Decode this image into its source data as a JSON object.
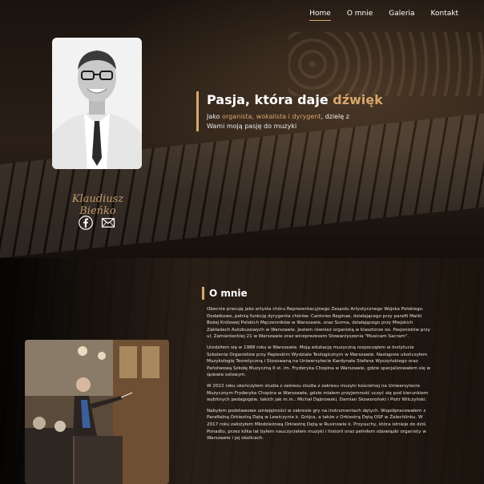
{
  "nav": {
    "items": [
      {
        "label": "Home",
        "active": true
      },
      {
        "label": "O mnie",
        "active": false
      },
      {
        "label": "Galeria",
        "active": false
      },
      {
        "label": "Kontakt",
        "active": false
      }
    ]
  },
  "hero": {
    "title_part1": "Pasja, która daje ",
    "title_accent": "dźwięk",
    "subtitle_part1": "Jako ",
    "subtitle_accent": "organista, wokalista i dyrygent",
    "subtitle_part2": ", dzielę z Wami moją pasję do muzyki",
    "signature": "Klaudiusz Bieńko",
    "socials": [
      {
        "icon": "facebook-icon"
      },
      {
        "icon": "mail-icon"
      }
    ]
  },
  "about": {
    "title": "O mnie",
    "paragraphs": [
      "Obecnie pracuję jako artysta chóru Reprezentacyjnego Zespołu Artystycznego Wojska Polskiego. Dodatkowo, pełnię funkcję dyrygenta chórów: Cantores Reginae, działającego przy parafii Matki Bożej Królowej Polskich Męczenników w Warszawie, oraz Surma, działającego przy Miejskich Zakładach Autobusowych w Warszawie. Jestem również organistą w klasztorze oo. Pasjonistów przy ul. Zamienieckiej 21 w Warszawie oraz wiceprezesem Stowarzyszenia \"Musicam Sacram\".",
      "Urodziłem się w 1988 roku w Warszawie. Moją edukację muzyczną rozpocząłem w Instytucie Szkolenia Organistów przy Papieskim Wydziale Teologicznym w Warszawie. Następnie ukończyłem Muzykologię Teoretyczną i Stosowaną na Uniwersytecie Kardynała Stefana Wyszyńskiego oraz Państwową Szkołę Muzyczną II st. im. Fryderyka Chopina w Warszawie, gdzie specjalizowałem się w śpiewie solowym.",
      "W 2022 roku ukończyłem studia z zakresu studia z zakresu muzyki kościelnej na Uniwersytecie Muzycznym Fryderyka Chopina w Warszawie, gdzie miałem przyjemność uczyć się pod kierunkiem wybitnych pedagogów, takich jak m.in.: Michał Dąbrowski, Damian Skoworoński i Piotr Wilczyński.",
      "Nabyłem podstawowe umiejętności w zakresie gry na instrumentach dętych. Współpracowałem z Parafialną Orkiestrą Dętą w Lewiczynie k. Grójca, a także z Orkiestrą Dętą OSP w Żelechlinku. W 2017 roku założyłem Młodzieżową Orkiestrę Dętą w Rusinowie k. Przysuchy, która istnieje do dziś. Ponadto, przez kilka lat byłem nauczycielem muzyki i historii oraz pełniłem obowiązki organisty w Warszawie i jej okolicach."
    ]
  },
  "colors": {
    "accent": "#d8a66e",
    "background": "#0d0b09",
    "signature": "#c39a6b"
  }
}
